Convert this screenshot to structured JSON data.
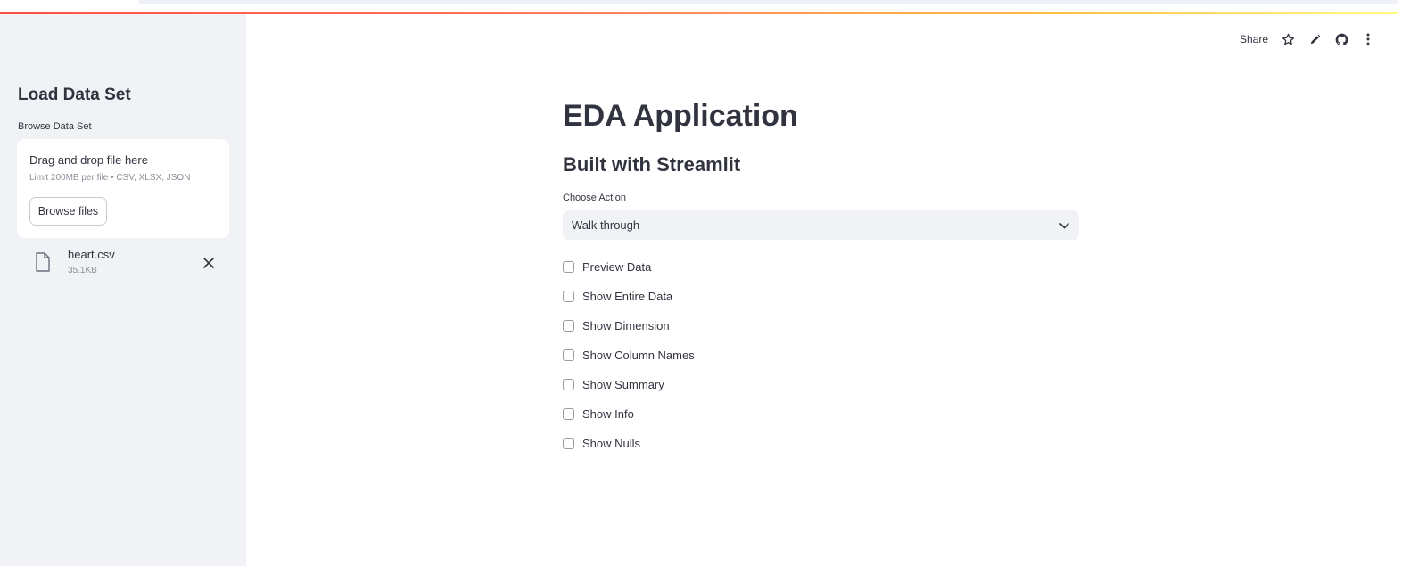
{
  "sidebar": {
    "title": "Load Data Set",
    "uploader": {
      "label": "Browse Data Set",
      "instructions": "Drag and drop file here",
      "limit": "Limit 200MB per file • CSV, XLSX, JSON",
      "browse_label": "Browse files"
    },
    "uploaded_file": {
      "name": "heart.csv",
      "size": "35.1KB",
      "icon": "file-icon"
    }
  },
  "toolbar": {
    "share_label": "Share",
    "icons": [
      "star-icon",
      "pencil-icon",
      "github-icon",
      "more-vertical-icon"
    ]
  },
  "main": {
    "title": "EDA Application",
    "subtitle": "Built with Streamlit",
    "select": {
      "label": "Choose Action",
      "value": "Walk through"
    },
    "checkboxes": [
      {
        "label": "Preview Data",
        "checked": false
      },
      {
        "label": "Show Entire Data",
        "checked": false
      },
      {
        "label": "Show Dimension",
        "checked": false
      },
      {
        "label": "Show Column Names",
        "checked": false
      },
      {
        "label": "Show Summary",
        "checked": false
      },
      {
        "label": "Show Info",
        "checked": false
      },
      {
        "label": "Show Nulls",
        "checked": false
      }
    ]
  },
  "colors": {
    "accent": "#ff4b4b",
    "sidebar_bg": "#f0f2f6",
    "text": "#31333f",
    "muted_text": "#8c8f99"
  }
}
